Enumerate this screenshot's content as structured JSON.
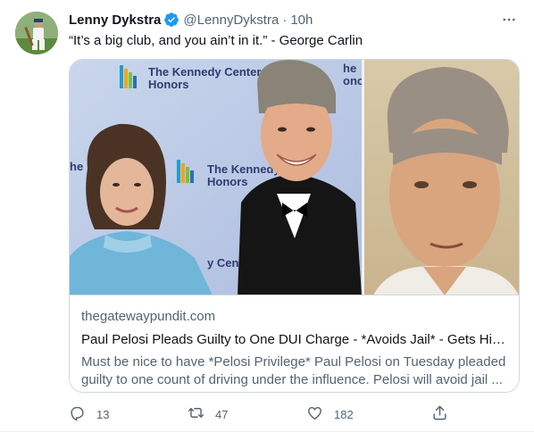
{
  "tweet": {
    "author_name": "Lenny Dykstra",
    "handle": "@LennyDykstra",
    "separator": "·",
    "time": "10h",
    "text": "“It’s a big club, and you ain’t in it.” - George Carlin"
  },
  "card": {
    "domain": "thegatewaypundit.com",
    "title": "Paul Pelosi Pleads Guilty to One DUI Charge - *Avoids Jail* - Gets Hit w...",
    "description": "Must be nice to have *Pelosi Privilege* Paul Pelosi on Tuesday pleaded guilty to one count of driving under the influence. Pelosi will avoid jail ...",
    "image_text": {
      "backdrop_logo_1": "The Kennedy Center\nHonors",
      "backdrop_logo_2": "The Kennedy\nHonors",
      "backdrop_fragment_right": "he\nonc",
      "backdrop_fragment_left": "he",
      "backdrop_fragment_bottom": "y Cen"
    }
  },
  "actions": {
    "replies": "13",
    "retweets": "47",
    "likes": "182"
  },
  "colors": {
    "verified": "#1d9bf0",
    "secondary_text": "#536471",
    "border": "#cfd9de"
  },
  "icons": [
    "verified-badge-icon",
    "more-options-icon",
    "reply-icon",
    "retweet-icon",
    "like-icon",
    "share-icon"
  ]
}
